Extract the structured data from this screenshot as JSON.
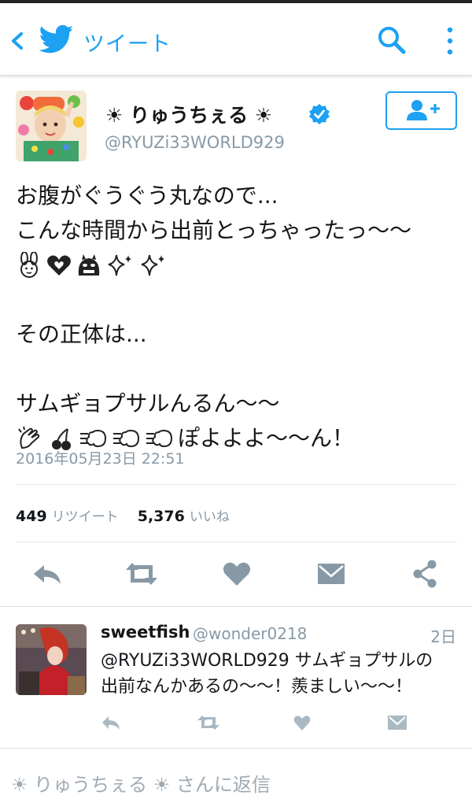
{
  "topbar": {
    "title": "ツイート",
    "back_icon": "chevron-left-icon",
    "logo_icon": "twitter-bird-icon",
    "search_icon": "search-icon",
    "menu_icon": "overflow-menu-icon"
  },
  "tweet": {
    "display_name": "☀ りゅうちぇる ☀",
    "handle": "@RYUZi33WORLD929",
    "verified": true,
    "follow_icon": "add-user-icon",
    "lines": [
      "お腹がぐうぐう丸なので...",
      "こんな時間から出前とっちゃったっ〜〜"
    ],
    "line_after_blank_1": "その正体は...",
    "line_3": "サムギョプサルんるん〜〜",
    "line_4_text": "ぽよよよ〜〜ん！",
    "emojis_row_1": [
      "bunny-girl-emoji",
      "heart-decoration-emoji",
      "ogre-emoji",
      "sparkles-emoji",
      "sparkles-emoji"
    ],
    "emojis_row_2": [
      "clapping-hands-emoji",
      "cherries-emoji",
      "dash-emoji",
      "dash-emoji",
      "dash-emoji"
    ],
    "timestamp": "2016年05月23日 22:51",
    "retweet_count": "449",
    "retweet_label": "リツイート",
    "like_count": "5,376",
    "like_label": "いいね"
  },
  "actions": [
    "reply-icon",
    "retweet-icon",
    "like-icon",
    "direct-message-icon",
    "share-icon"
  ],
  "reply": {
    "name": "sweetfish",
    "handle": "@wonder0218",
    "time": "2日",
    "line_1": "@RYUZi33WORLD929 サムギョプサルの",
    "line_2": "出前なんかあるの〜〜！羨ましい〜〜！"
  },
  "compose": {
    "placeholder": "☀ りゅうちぇる ☀ さんに返信"
  },
  "colors": {
    "accent": "#1da1f2",
    "action_gray": "#8899a6",
    "text": "#14171a",
    "muted": "#8899a6"
  }
}
